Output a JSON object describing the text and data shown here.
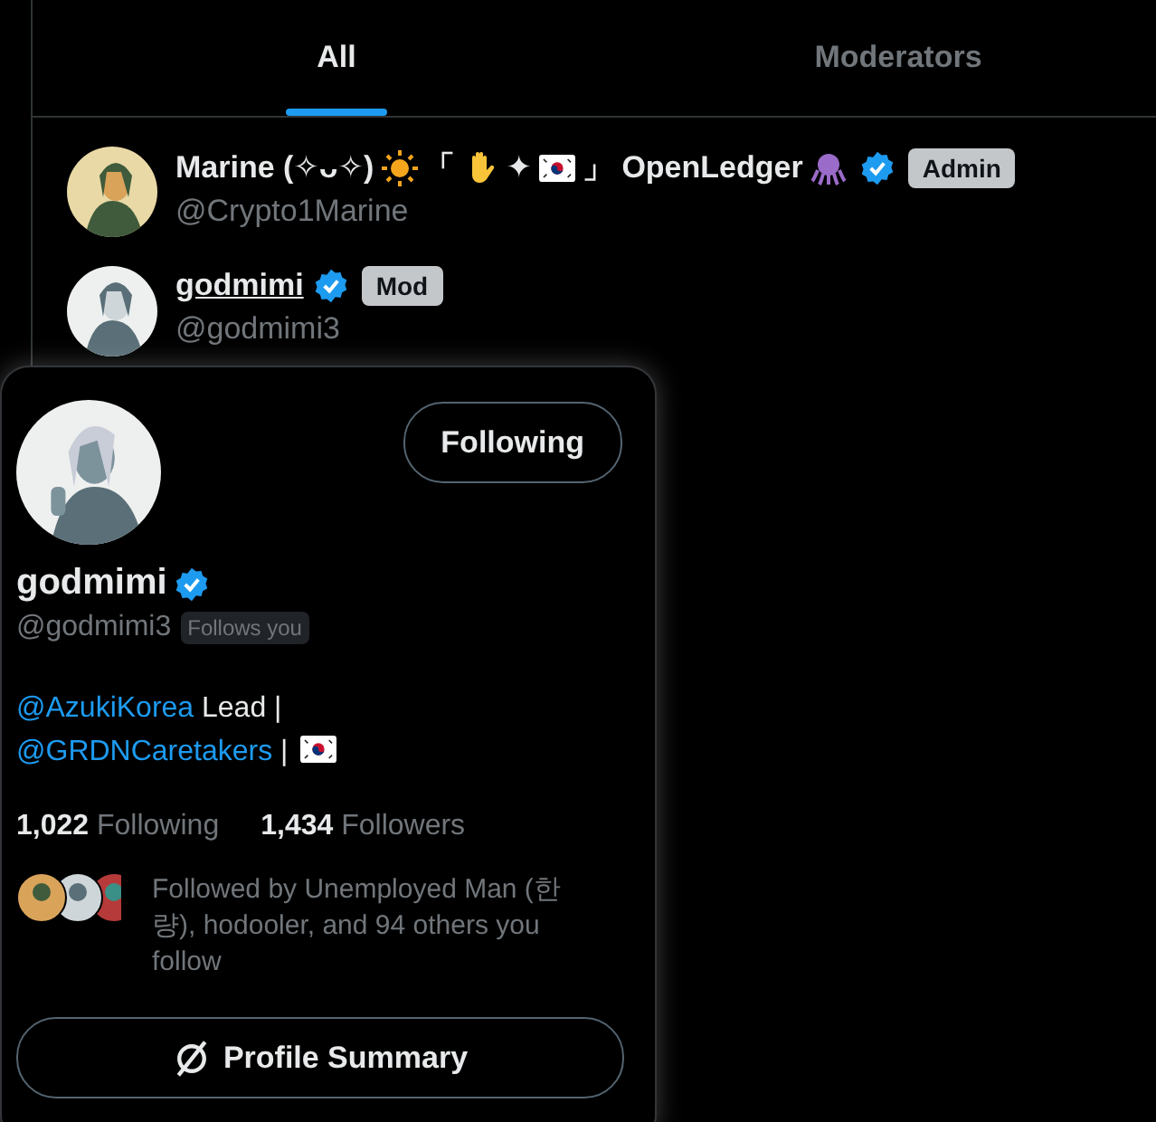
{
  "tabs": [
    {
      "label": "All",
      "selected": true
    },
    {
      "label": "Moderators",
      "selected": false
    }
  ],
  "members": [
    {
      "name_parts": [
        {
          "kind": "text",
          "text": "Marine (✧ᴗ✧)"
        },
        {
          "kind": "sun"
        },
        {
          "kind": "text",
          "text": "「"
        },
        {
          "kind": "hand"
        },
        {
          "kind": "text",
          "text": "✦"
        },
        {
          "kind": "flag"
        },
        {
          "kind": "text",
          "text": "」 OpenLedger"
        },
        {
          "kind": "octopus"
        }
      ],
      "verified": true,
      "role": "Admin",
      "handle": "@Crypto1Marine",
      "underlined": false
    },
    {
      "name_parts": [
        {
          "kind": "text",
          "text": "godmimi"
        }
      ],
      "verified": true,
      "role": "Mod",
      "handle": "@godmimi3",
      "underlined": true
    }
  ],
  "card": {
    "follow_button": "Following",
    "name": "godmimi",
    "verified": true,
    "handle": "@godmimi3",
    "follows_you": "Follows you",
    "bio": [
      {
        "kind": "link",
        "text": "@AzukiKorea"
      },
      {
        "kind": "text",
        "text": " Lead |"
      },
      {
        "kind": "break"
      },
      {
        "kind": "link",
        "text": "@GRDNCaretakers"
      },
      {
        "kind": "text",
        "text": " | "
      },
      {
        "kind": "flag"
      }
    ],
    "following_count": "1,022",
    "following_label": "Following",
    "followers_count": "1,434",
    "followers_label": "Followers",
    "followed_by": "Followed by Unemployed Man (한량), hodooler, and 94 others you follow",
    "summary_button": "Profile Summary"
  }
}
